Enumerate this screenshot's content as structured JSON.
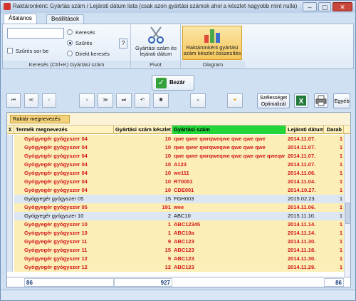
{
  "window": {
    "title": "Raktáronként: Gyártás szám / Lejárati dátum lista (csak azon gyártási számok ahol a készlet nagyobb mint nulla)",
    "minimize": "–",
    "maximize": "▢",
    "close": "✕"
  },
  "tabs": [
    {
      "label": "Általános"
    },
    {
      "label": "Beállítások"
    }
  ],
  "ribbon": {
    "search": {
      "input_value": "",
      "filter_checkbox_label": "Szűrés sor be",
      "radio": [
        "Keresés",
        "Szűrés",
        "Direkt keresés"
      ],
      "selected_radio": "Szűrés",
      "help_button": "?",
      "caption": "Keresés (Ctrl+K) Gyártási szám"
    },
    "pivot": {
      "button_label": "Gyártási szám és lejárati dátum",
      "caption": "Pivot"
    },
    "diagram": {
      "button_label": "Raktáronként gyártási szám készlet összesítés",
      "caption": "Diagram"
    }
  },
  "close_button": "Bezár",
  "toolbar": {
    "nav_buttons": [
      "⏮",
      "≪",
      "‹",
      "›",
      "≫",
      "⏭",
      "↶",
      "✱",
      "⁎",
      "⏷"
    ],
    "width_button": "Szélességet Optimalizál",
    "other_button": "Egyéb"
  },
  "grid": {
    "group_label": "Raktár megnevezés",
    "columns": [
      "Termék megnevezés",
      "Gyártási szám készlet",
      "Gyártási szám",
      "Lejárati dátum",
      "Darab"
    ],
    "rows": [
      {
        "name": "Gyógyegér gyógyszer 04",
        "stock": "10",
        "batch": "qwe qwer qwrqweqwe qwe qwe qwe",
        "date": "2014.11.07.",
        "qty": "1",
        "style": "red"
      },
      {
        "name": "Gyógyegér gyógyszer 04",
        "stock": "10",
        "batch": "qwe qwer qwrqweqwe qwe qwe qwe",
        "date": "2014.11.07.",
        "qty": "1",
        "style": "red"
      },
      {
        "name": "Gyógyegér gyógyszer 04",
        "stock": "10",
        "batch": "qwe qwer qwrqweqwe qwe qwe qwe qweqw",
        "date": "2014.11.07.",
        "qty": "1",
        "style": "red"
      },
      {
        "name": "Gyógyegér gyógyszer 04",
        "stock": "10",
        "batch": "A123",
        "date": "2014.11.07.",
        "qty": "1",
        "style": "red"
      },
      {
        "name": "Gyógyegér gyógyszer 04",
        "stock": "10",
        "batch": "we111",
        "date": "2014.11.06.",
        "qty": "1",
        "style": "red"
      },
      {
        "name": "Gyógyegér gyógyszer 04",
        "stock": "10",
        "batch": "RT0001",
        "date": "2014.11.04.",
        "qty": "1",
        "style": "red"
      },
      {
        "name": "Gyógyegér gyógyszer 04",
        "stock": "10",
        "batch": "CDE001",
        "date": "2014.10.27.",
        "qty": "1",
        "style": "red"
      },
      {
        "name": "Gyógyegér gyógyszer 05",
        "stock": "15",
        "batch": "FGH003",
        "date": "2015.02.23.",
        "qty": "1",
        "style": "dark"
      },
      {
        "name": "Gyógyegér gyógyszer 05",
        "stock": "191",
        "batch": "wee",
        "date": "2014.11.06.",
        "qty": "1",
        "style": "red"
      },
      {
        "name": "Gyógyegér gyógyszer 10",
        "stock": "2",
        "batch": "ABC10",
        "date": "2015.11.10.",
        "qty": "1",
        "style": "dark"
      },
      {
        "name": "Gyógyegér gyógyszer 10",
        "stock": "1",
        "batch": "ABC12345",
        "date": "2014.11.14.",
        "qty": "1",
        "style": "red"
      },
      {
        "name": "Gyógyegér gyógyszer 10",
        "stock": "1",
        "batch": "ABC10a",
        "date": "2014.11.14.",
        "qty": "1",
        "style": "red"
      },
      {
        "name": "Gyógyegér gyógyszer 11",
        "stock": "9",
        "batch": "ABC123",
        "date": "2014.11.30.",
        "qty": "1",
        "style": "red"
      },
      {
        "name": "Gyógyegér gyógyszer 11",
        "stock": "15",
        "batch": "ABC123",
        "date": "2014.11.18.",
        "qty": "1",
        "style": "red"
      },
      {
        "name": "Gyógyegér gyógyszer 12",
        "stock": "9",
        "batch": "ABC123",
        "date": "2014.11.30.",
        "qty": "1",
        "style": "red"
      },
      {
        "name": "Gyógyegér gyógyszer 12",
        "stock": "12",
        "batch": "ABC123",
        "date": "2014.11.29.",
        "qty": "1",
        "style": "red"
      }
    ],
    "footer": {
      "count": "86",
      "stock_total": "927",
      "qty_total": "86"
    }
  },
  "colors": {
    "row_red_text": "#d41919",
    "row_yellow_bg": "#fbeeb6",
    "batch_header_bg": "#22d63a",
    "ribbon_highlight": "#f5c65a"
  }
}
